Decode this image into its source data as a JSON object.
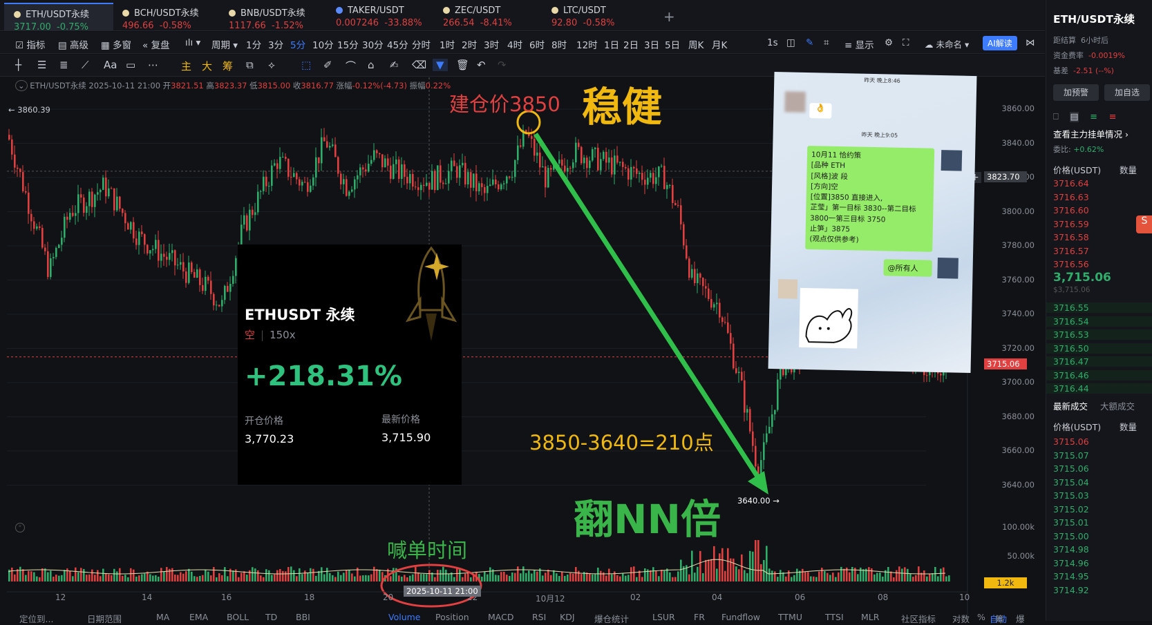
{
  "tabs": [
    {
      "name": "ETH/USDT永续",
      "price": "3717.00",
      "change": "-0.75%",
      "color": "green"
    },
    {
      "name": "BCH/USDT永续",
      "price": "496.66",
      "change": "-0.58%",
      "color": "red"
    },
    {
      "name": "BNB/USDT永续",
      "price": "1117.66",
      "change": "-1.52%",
      "color": "red"
    },
    {
      "name": "TAKER/USDT",
      "price": "0.007246",
      "change": "-33.88%",
      "color": "red"
    },
    {
      "name": "ZEC/USDT",
      "price": "266.54",
      "change": "-8.41%",
      "color": "red"
    },
    {
      "name": "LTC/USDT",
      "price": "92.80",
      "change": "-0.58%",
      "color": "red"
    }
  ],
  "add_tab": "+",
  "toolbar": {
    "indicator": "指标",
    "advanced": "高级",
    "multi": "多窗",
    "replay": "复盘",
    "period": "周期",
    "intervals": [
      "1分",
      "3分",
      "5分",
      "10分",
      "15分",
      "30分",
      "45分",
      "分时",
      "1时",
      "2时",
      "3时",
      "4时",
      "6时",
      "8时",
      "12时",
      "1日",
      "2日",
      "3日",
      "5日",
      "周K",
      "月K"
    ],
    "selected_interval": "5分",
    "right_label": "1s",
    "display": "显示",
    "unnamed": "未命名",
    "ai": "AI解读"
  },
  "drawtools": [
    "主",
    "大",
    "筹"
  ],
  "info_line": {
    "symbol": "ETH/USDT永续",
    "time": "2025-10-11 21:00",
    "open_l": "开",
    "open": "3821.51",
    "high_l": "高",
    "high": "3823.37",
    "low_l": "低",
    "low": "3815.00",
    "close_l": "收",
    "close": "3816.77",
    "chg_l": "涨幅",
    "chg": "-0.12%(-4.73)",
    "amp_l": "振幅",
    "amp": "0.22%"
  },
  "y_axis": [
    "3860.00",
    "3840.00",
    "3820.00",
    "3800.00",
    "3780.00",
    "3760.00",
    "3740.00",
    "3720.00",
    "3700.00",
    "3680.00",
    "3660.00",
    "3640.00"
  ],
  "price_tags": {
    "high_marker": "3860.39",
    "crosshair": "3823.70",
    "last": "3715.06",
    "low_marker": "3640.00"
  },
  "vol_axis": [
    "100.00k",
    "50.00k"
  ],
  "vol_tag": "1.2k",
  "x_axis": [
    "12",
    "14",
    "16",
    "18",
    "20",
    "2025-10-11 21:00",
    "22",
    "10月12",
    "02",
    "04",
    "06",
    "08",
    "10"
  ],
  "bottom_tabs": [
    "定位到...",
    "日期范围",
    "MA",
    "EMA",
    "BOLL",
    "TD",
    "BBI",
    "Volume",
    "Position",
    "MACD",
    "RSI",
    "KDJ",
    "爆仓统计",
    "LSUR",
    "FR",
    "Fundflow",
    "TTMU",
    "TTSI",
    "MLR",
    "社区指标",
    "对数",
    "%",
    "自动"
  ],
  "bottom_right": [
    "筹",
    "爆"
  ],
  "annotations": {
    "entry": "建仓价3850",
    "steady": "稳健",
    "calc": "3850-3640=210点",
    "multiply": "翻NN倍",
    "call_time": "喊单时间"
  },
  "card": {
    "title": "ETHUSDT 永续",
    "side": "空",
    "leverage": "150x",
    "pnl": "+218.31%",
    "open_label": "开仓价格",
    "open_price": "3,770.23",
    "last_label": "最新价格",
    "last_price": "3,715.90"
  },
  "chat": {
    "time1": "昨天 晚上8:46",
    "emoji": "👌",
    "time2": "昨天 晚上9:05",
    "lines": [
      "10月11 恰约策",
      "[品种 ETH",
      "[风格]波  段",
      "[方向]空",
      "[位置]3850 直接进入,",
      "芷莹」第一目标 3830--第二目标",
      "3800一第三目标 3750",
      "止笋」3875",
      "(观点仅供参考)"
    ],
    "mention": "@所有人"
  },
  "panel": {
    "title": "ETH/USDT永续",
    "settle_l": "距结算",
    "settle": "6小时后",
    "fund_l": "资金费率",
    "fund": "-0.0019%",
    "basis_l": "基差",
    "basis": "-2.51 (--%)",
    "btn_alert": "加预警",
    "btn_fav": "加自选",
    "depth_link": "查看主力挂单情况",
    "ratio_l": "委比:",
    "ratio": "+0.62%",
    "col_price": "价格(USDT)",
    "col_qty": "数量",
    "asks": [
      "3716.64",
      "3716.63",
      "3716.60",
      "3716.59",
      "3716.58",
      "3716.57",
      "3716.56"
    ],
    "mid": "3,715.06",
    "mid_sub": "$3,715.06",
    "bids": [
      "3716.55",
      "3716.54",
      "3716.53",
      "3716.50",
      "3716.47",
      "3716.46",
      "3716.44"
    ],
    "trades_tab": "最新成交",
    "big_tab": "大额成交",
    "col_price2": "价格(USDT)",
    "col_qty2": "数量",
    "trades": [
      "3715.06",
      "3715.07",
      "3715.06",
      "3715.04",
      "3715.03",
      "3715.02",
      "3715.01",
      "3715.00",
      "3714.98",
      "3714.96",
      "3714.95",
      "3714.92"
    ],
    "trade_colors": [
      "red",
      "green",
      "green",
      "green",
      "green",
      "green",
      "green",
      "green",
      "green",
      "green",
      "green",
      "green"
    ]
  }
}
